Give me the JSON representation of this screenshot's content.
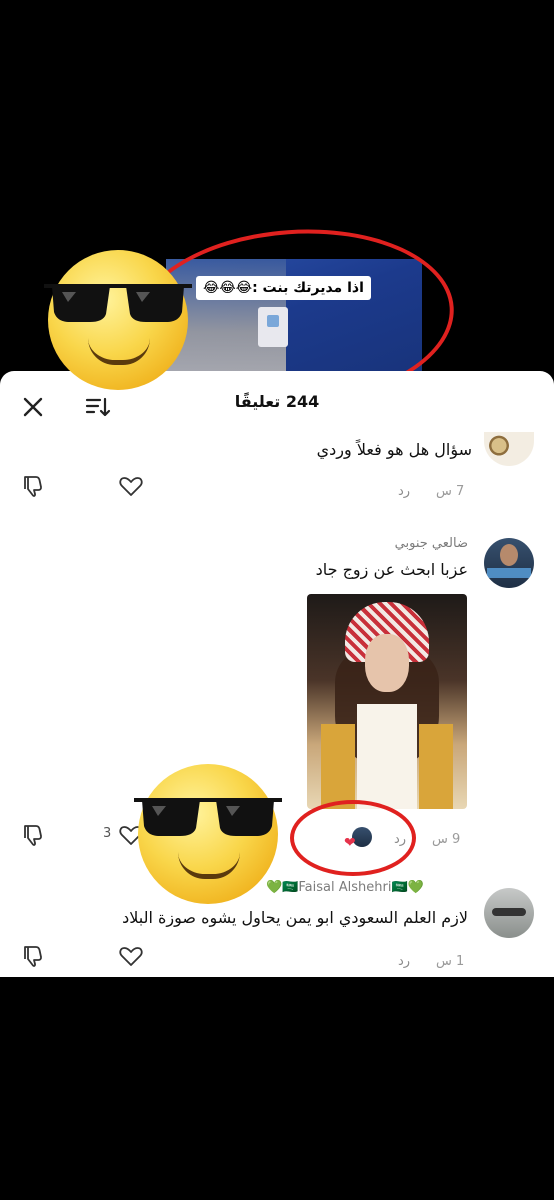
{
  "video": {
    "caption": "اذا مديرتك بنت :😂😂😂"
  },
  "panel": {
    "comments_count": "244 تعليقًا"
  },
  "comments": [
    {
      "text": "سؤال هل هو فعلاً وردي",
      "time": "7 س",
      "reply_label": "رد"
    },
    {
      "username": "ضالعي جنوبي",
      "text": "عزبا ابحث عن زوج جاد",
      "time": "9 س",
      "reply_label": "رد",
      "likes": "3"
    },
    {
      "username": "Faisal Alshehri",
      "username_decor_before": "💚🇸🇦",
      "username_decor_after": "🇸🇦💚",
      "text": "لازم العلم السعودي ابو يمن يحاول يشوه صوزة البلاد",
      "time": "1 س",
      "reply_label": "رد"
    }
  ],
  "icons": {
    "close": "close-icon",
    "sort": "sort-icon",
    "like": "heart-outline-icon",
    "dislike": "thumbs-down-icon"
  },
  "colors": {
    "annotation_red": "#e0211f",
    "creator_heart": "#e5334b",
    "background": "#000000",
    "panel": "#ffffff"
  }
}
